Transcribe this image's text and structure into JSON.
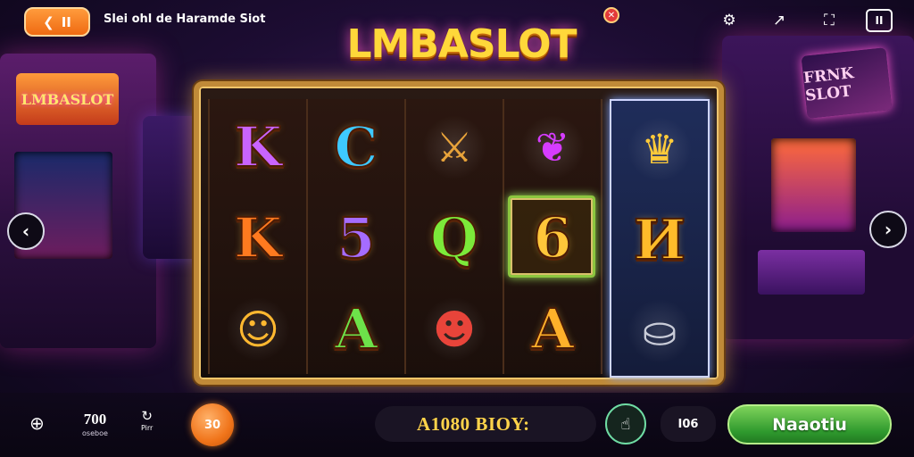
{
  "header": {
    "back_label": "II",
    "title": "Slei ohl de Haramde Siot",
    "icons": [
      "settings-icon",
      "share-icon",
      "fullscreen-icon",
      "menu-icon"
    ],
    "menu_label": "II"
  },
  "logo": {
    "text": "LMBASLOT",
    "badge": "✕"
  },
  "background": {
    "left_marquee": "LMBASLOT",
    "right_sign": "FRNK SLOT"
  },
  "reels": [
    [
      {
        "type": "letter",
        "text": "K",
        "color": "#c964ff",
        "name": "purple-k-symbol"
      },
      {
        "type": "letter",
        "text": "K",
        "color": "#ff7a1f",
        "name": "orange-k-symbol"
      },
      {
        "type": "icon",
        "glyph": "☺",
        "color": "#ffb830",
        "name": "gold-bear-symbol"
      }
    ],
    [
      {
        "type": "letter",
        "text": "C",
        "color": "#3ec9ff",
        "name": "blue-c-symbol"
      },
      {
        "type": "letter",
        "text": "5",
        "color": "#a56cff",
        "name": "purple-5-symbol"
      },
      {
        "type": "letter",
        "text": "A",
        "color": "#6de24a",
        "name": "green-a-symbol"
      }
    ],
    [
      {
        "type": "icon",
        "glyph": "⚔",
        "color": "#e8a33a",
        "name": "sword-emblem-symbol"
      },
      {
        "type": "letter",
        "text": "Q",
        "color": "#7cea3a",
        "name": "green-q-symbol"
      },
      {
        "type": "icon",
        "glyph": "☻",
        "color": "#e8443a",
        "name": "clown-face-symbol"
      }
    ],
    [
      {
        "type": "icon",
        "glyph": "❦",
        "color": "#d63cff",
        "name": "magenta-heart-symbol"
      },
      {
        "type": "letter",
        "text": "6",
        "color": "#ffc63a",
        "name": "gold-6-symbol",
        "win": true
      },
      {
        "type": "letter",
        "text": "A",
        "color": "#ffb02a",
        "name": "orange-a-symbol"
      }
    ],
    [
      {
        "type": "icon",
        "glyph": "♛",
        "color": "#ffcb3a",
        "name": "treasure-pot-symbol"
      },
      {
        "type": "letter",
        "text": "И",
        "color": "#ffbb2a",
        "name": "gold-rune-symbol"
      },
      {
        "type": "icon",
        "glyph": "⛀",
        "color": "#c9ccd8",
        "name": "silver-bucket-symbol"
      }
    ]
  ],
  "bottom_bar": {
    "bet_value": "700",
    "bet_label": "oseboe",
    "max_label": "Pirr",
    "chip_value": "30",
    "balance": "A1080 BIOY:",
    "lines": "I06",
    "spin_label": "Naaotiu"
  }
}
